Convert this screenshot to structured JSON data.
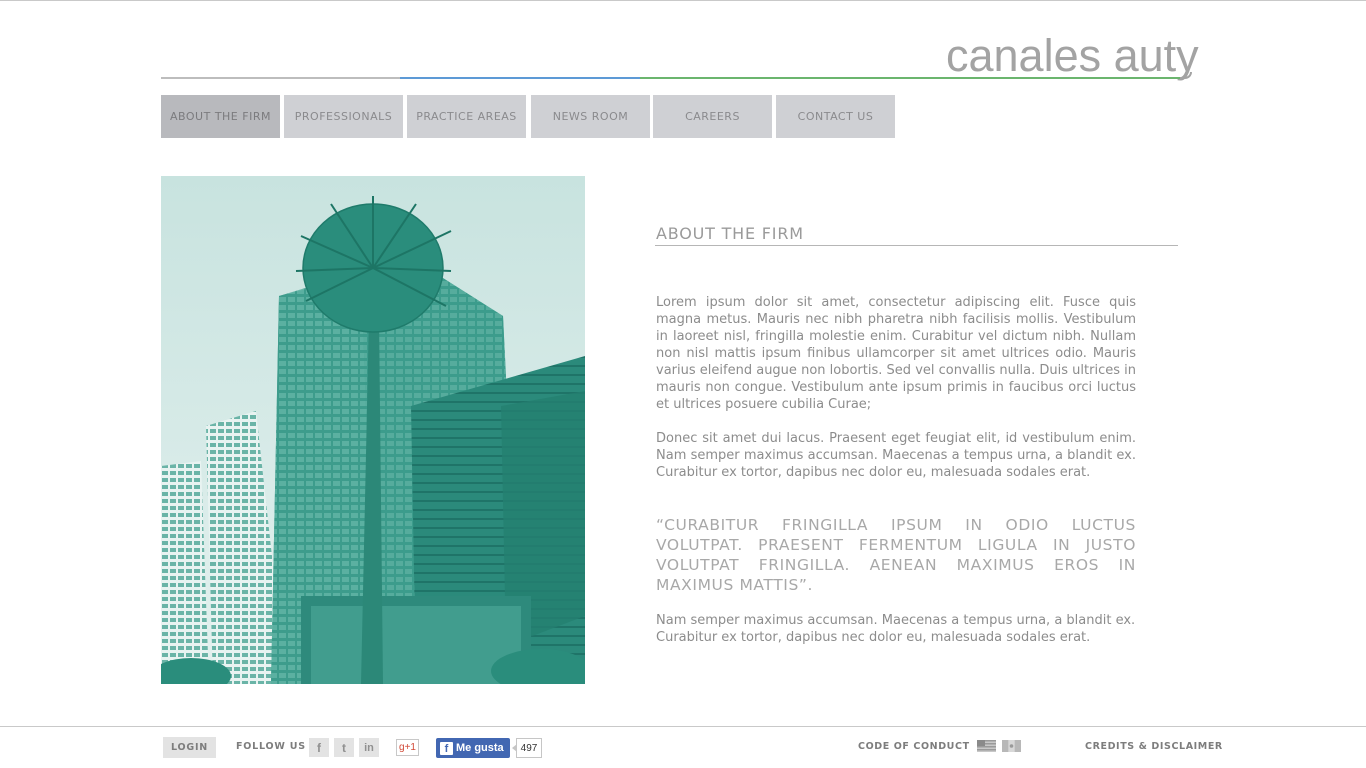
{
  "brand": {
    "logo_text": "canales auty"
  },
  "nav": {
    "items": [
      {
        "label": "ABOUT THE FIRM",
        "active": true
      },
      {
        "label": "PROFESSIONALS",
        "active": false
      },
      {
        "label": "PRACTICE AREAS",
        "active": false
      },
      {
        "label": "NEWS ROOM",
        "active": false
      },
      {
        "label": "CAREERS",
        "active": false
      },
      {
        "label": "CONTACT US",
        "active": false
      }
    ]
  },
  "main": {
    "title": "ABOUT THE FIRM",
    "paragraphs": [
      "Lorem ipsum dolor sit amet, consectetur adipiscing elit. Fusce quis magna metus. Mauris nec nibh pharetra nibh facilisis mollis. Vestibulum in laoreet nisl, fringilla molestie enim. Curabitur vel dictum nibh. Nullam non nisl mattis ipsum finibus ullamcorper sit amet ultrices odio. Mauris varius eleifend augue non lobortis. Sed vel convallis nulla. Duis ultrices in mauris non congue. Vestibulum ante ipsum primis in faucibus orci luctus et ultrices posuere cubilia Curae;",
      "Donec sit amet dui lacus. Praesent eget feugiat elit, id vestibulum enim. Nam semper maximus accumsan. Maecenas a tempus urna, a blandit ex. Curabitur ex tortor, dapibus nec dolor eu, malesuada sodales erat.",
      "Nam semper maximus accumsan. Maecenas a tempus urna, a blandit ex. Curabitur ex tortor, dapibus nec dolor eu, malesuada sodales erat."
    ],
    "quote": "“CURABITUR FRINGILLA IPSUM IN ODIO LUCTUS VOLUTPAT. PRAESENT FERMENTUM LIGULA IN JUSTO VOLUTPAT FRINGILLA. AENEAN MAXIMUS EROS IN MAXIMUS MATTIS”."
  },
  "footer": {
    "login_label": "LOGIN",
    "follow_label": "FOLLOW US",
    "social": [
      {
        "icon": "facebook-icon",
        "glyph": "f"
      },
      {
        "icon": "twitter-icon",
        "glyph": "t"
      },
      {
        "icon": "linkedin-icon",
        "glyph": "in"
      }
    ],
    "gplus_label": "g+1",
    "fb_like_label": "Me gusta",
    "fb_like_count": "497",
    "code_label": "CODE OF CONDUCT",
    "credits_label": "CREDITS & DISCLAIMER"
  },
  "colors": {
    "accent_blue": "#5d9ad6",
    "accent_green": "#6bb56e",
    "hero_tint": "#2e9c8b",
    "facebook_blue": "#4267b2"
  }
}
